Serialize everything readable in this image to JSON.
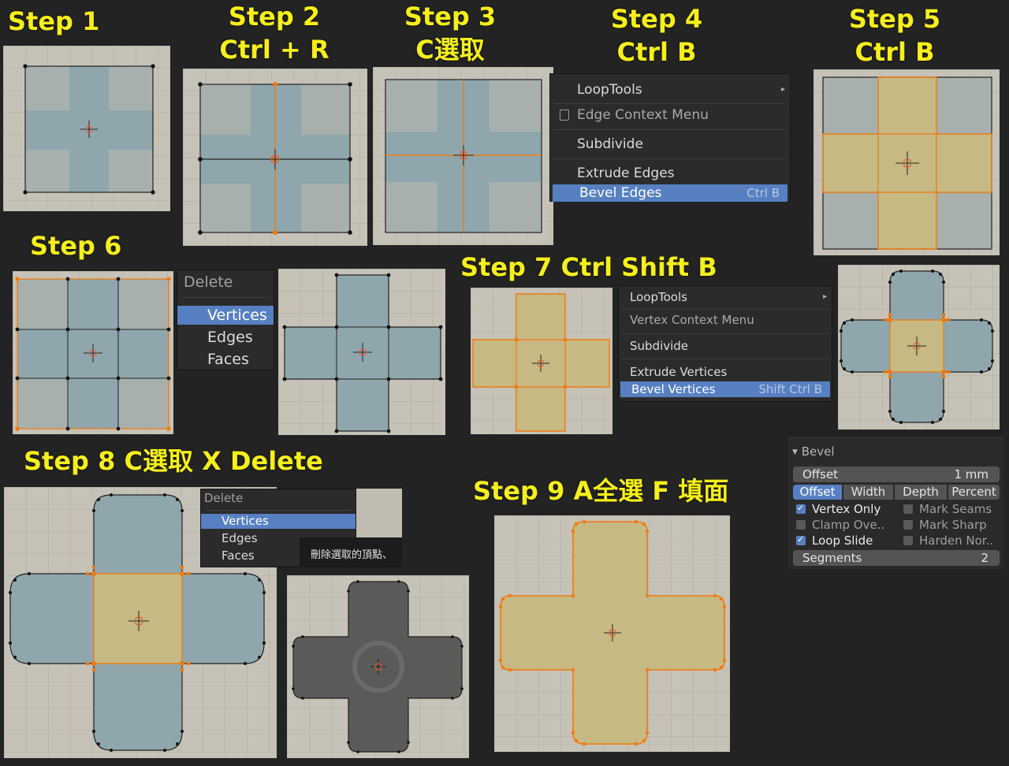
{
  "steps": {
    "s1": "Step 1",
    "s2_a": "Step 2",
    "s2_b": "Ctrl + R",
    "s3_a": "Step 3",
    "s3_b": "C選取",
    "s4_a": "Step 4",
    "s4_b": "Ctrl B",
    "s5_a": "Step 5",
    "s5_b": "Ctrl B",
    "s6": "Step 6",
    "s7": "Step 7  Ctrl Shift B",
    "s8": "Step 8  C選取  X Delete",
    "s9": "Step 9  A全選  F 填面"
  },
  "edge_menu": {
    "loop_tools": "LoopTools",
    "context": "Edge Context Menu",
    "subdivide": "Subdivide",
    "extrude": "Extrude Edges",
    "bevel": "Bevel Edges",
    "bevel_shortcut": "Ctrl B"
  },
  "delete_menu_1": {
    "title": "Delete",
    "vertices": "Vertices",
    "edges": "Edges",
    "faces": "Faces"
  },
  "vertex_menu": {
    "loop_tools": "LoopTools",
    "context": "Vertex Context Menu",
    "subdivide": "Subdivide",
    "extrude": "Extrude Vertices",
    "bevel": "Bevel Vertices",
    "bevel_shortcut": "Shift Ctrl B"
  },
  "bevel_panel": {
    "title": "Bevel",
    "offset_label": "Offset",
    "offset_value": "1 mm",
    "modes": [
      "Offset",
      "Width",
      "Depth",
      "Percent"
    ],
    "vertex_only": "Vertex Only",
    "mark_seams": "Mark Seams",
    "clamp": "Clamp Ove..",
    "mark_sharp": "Mark Sharp",
    "loop_slide": "Loop Slide",
    "harden": "Harden Nor..",
    "segments_label": "Segments",
    "segments_value": "2"
  },
  "delete_menu_2": {
    "title": "Delete",
    "vertices": "Vertices",
    "edges": "Edges",
    "faces": "Faces",
    "tooltip": "刪除選取的頂點、"
  },
  "colors": {
    "accent": "#5680c2",
    "step_title": "#f5ef1b",
    "selection_orange": "#f07a10",
    "face_blue": "#8fa7ac",
    "face_yellow": "#c6b984"
  }
}
